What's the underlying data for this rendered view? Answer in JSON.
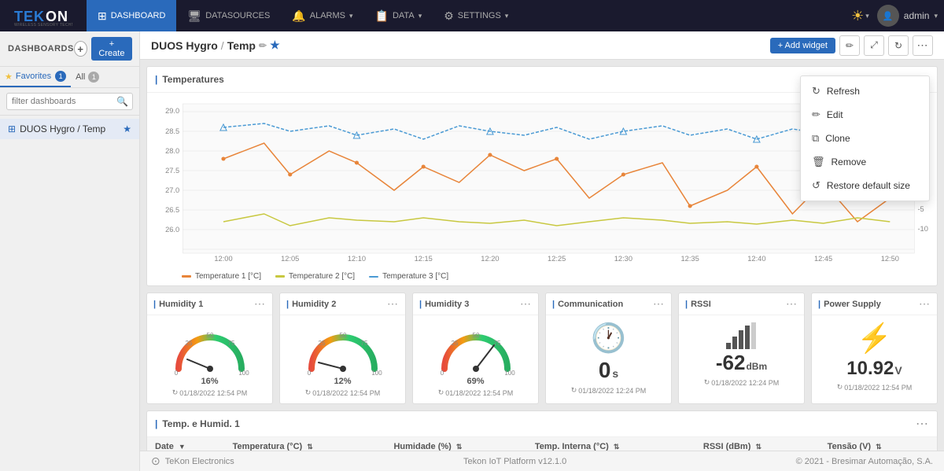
{
  "brand": {
    "name": "TEKON",
    "tagline": "WIRELESS SENSORY TECHNOLOGY"
  },
  "navbar": {
    "items": [
      {
        "id": "dashboard",
        "label": "DASHBOARD",
        "active": true
      },
      {
        "id": "datasources",
        "label": "DATASOURCES",
        "active": false
      },
      {
        "id": "alarms",
        "label": "ALARMS",
        "active": false,
        "has_caret": true
      },
      {
        "id": "data",
        "label": "DATA",
        "active": false,
        "has_caret": true
      },
      {
        "id": "settings",
        "label": "SETTINGS",
        "active": false,
        "has_caret": true
      }
    ],
    "user": "admin",
    "theme_icon": "☀"
  },
  "sidebar": {
    "header": "DASHBOARDS",
    "create_label": "+ Create",
    "tabs": [
      {
        "label": "★ Favorites",
        "count": "1",
        "active": true
      },
      {
        "label": "All",
        "count": "1",
        "active": false
      }
    ],
    "filter_placeholder": "filter dashboards",
    "items": [
      {
        "label": "DUOS Hygro / Temp",
        "starred": true
      }
    ]
  },
  "topbar": {
    "title": "DUOS Hygro",
    "separator": "/",
    "subtitle": "Temp",
    "add_widget_label": "+ Add widget"
  },
  "dropdown_menu": {
    "items": [
      {
        "id": "refresh",
        "label": "Refresh",
        "icon": "↻"
      },
      {
        "id": "edit",
        "label": "Edit",
        "icon": "✏"
      },
      {
        "id": "clone",
        "label": "Clone",
        "icon": "⧉"
      },
      {
        "id": "remove",
        "label": "Remove",
        "icon": "🗑"
      },
      {
        "id": "restore",
        "label": "Restore default size",
        "icon": "↺"
      }
    ]
  },
  "temperatures_widget": {
    "title": "Temperatures",
    "legend": [
      {
        "label": "Temperature 1 [°C]",
        "color": "#e8853a"
      },
      {
        "label": "Temperature 2 [°C]",
        "color": "#c8c840"
      },
      {
        "label": "Temperature 3 [°C]",
        "color": "#4a9ad4"
      }
    ]
  },
  "humidity_widgets": [
    {
      "title": "Humidity 1",
      "value": "16%",
      "timestamp": "01/18/2022 12:54 PM"
    },
    {
      "title": "Humidity 2",
      "value": "12%",
      "timestamp": "01/18/2022 12:54 PM"
    },
    {
      "title": "Humidity 3",
      "value": "69%",
      "timestamp": "01/18/2022 12:54 PM"
    }
  ],
  "communication_widget": {
    "title": "Communication",
    "value": "0",
    "unit": "s",
    "timestamp": "01/18/2022 12:24 PM"
  },
  "rssi_widget": {
    "title": "RSSI",
    "value": "-62",
    "unit": "dBm",
    "timestamp": "01/18/2022 12:24 PM"
  },
  "power_supply_widget": {
    "title": "Power Supply",
    "value": "10.92",
    "unit": "V",
    "timestamp": "01/18/2022 12:54 PM"
  },
  "table_widget": {
    "title": "Temp. e Humid. 1",
    "columns": [
      {
        "label": "Date",
        "sortable": true
      },
      {
        "label": "Temperatura (°C)",
        "sortable": true
      },
      {
        "label": "Humidade (%)",
        "sortable": true
      },
      {
        "label": "Temp. Interna (°C)",
        "sortable": true
      },
      {
        "label": "RSSI (dBm)",
        "sortable": true
      },
      {
        "label": "Tensão (V)",
        "sortable": true
      }
    ]
  },
  "footer": {
    "brand_label": "TeKon Electronics",
    "platform": "Tekon IoT Platform v12.1.0",
    "copyright": "© 2021 - Bresimar Automação, S.A."
  }
}
